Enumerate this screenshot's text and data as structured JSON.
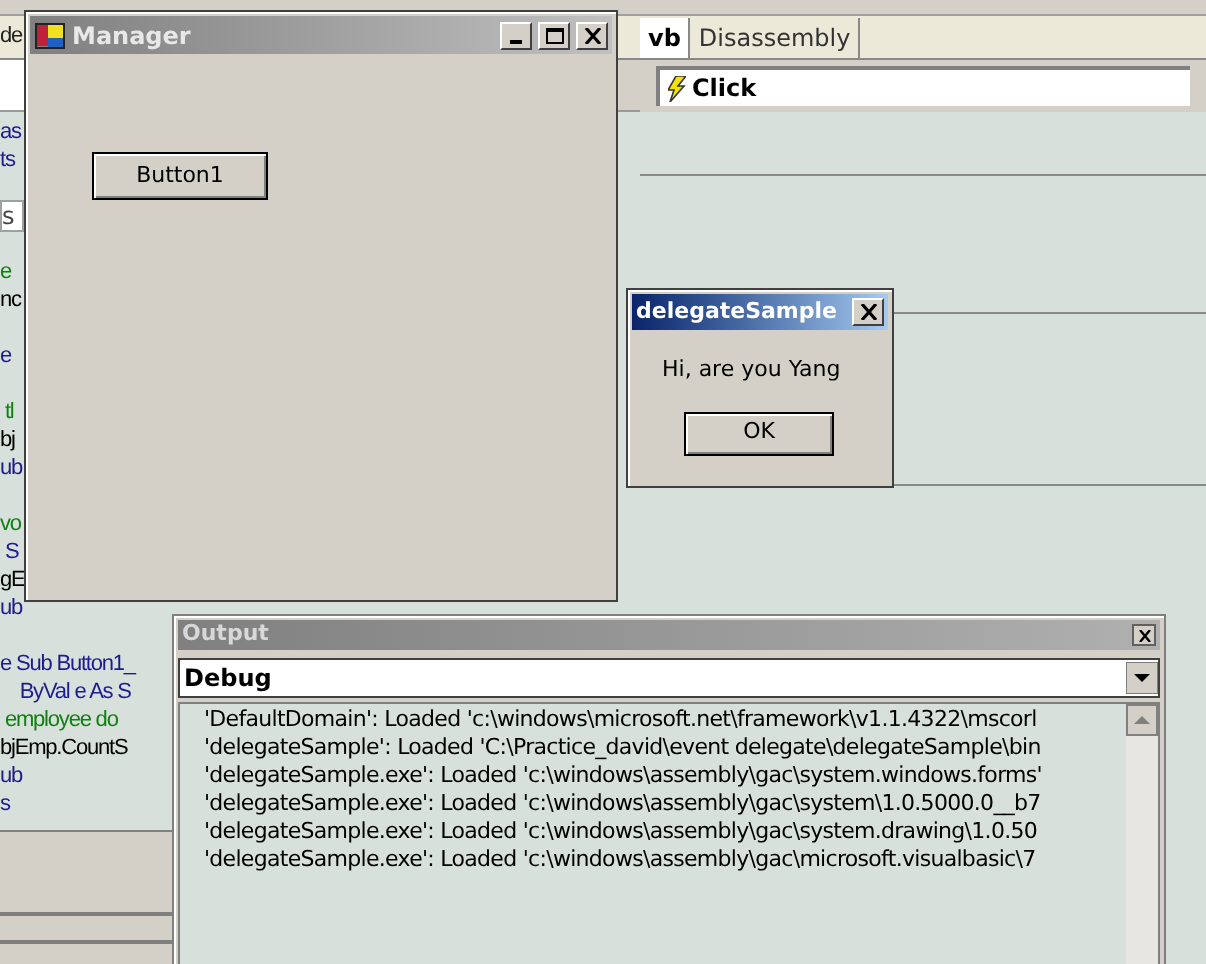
{
  "ide": {
    "left_tab": "de",
    "tabs": [
      {
        "label": "vb",
        "selected": true
      },
      {
        "label": "Disassembly",
        "selected": false
      }
    ],
    "event_combo": {
      "value": "Click"
    },
    "code_lines": [
      {
        "kind": "keyword",
        "text": "as"
      },
      {
        "kind": "keyword",
        "text": "ts"
      },
      {
        "kind": "blank"
      },
      {
        "kind": "field",
        "text": "s"
      },
      {
        "kind": "blank"
      },
      {
        "kind": "comment",
        "text": "e"
      },
      {
        "kind": "plain",
        "text": "nc"
      },
      {
        "kind": "blank"
      },
      {
        "kind": "keyword",
        "text": "e"
      },
      {
        "kind": "blank"
      },
      {
        "kind": "comment",
        "text": " tl"
      },
      {
        "kind": "plain",
        "text": "bj"
      },
      {
        "kind": "keyword",
        "text": "ub"
      },
      {
        "kind": "blank"
      },
      {
        "kind": "comment",
        "text": "vo"
      },
      {
        "kind": "keyword",
        "text": " S"
      },
      {
        "kind": "plain",
        "text": "gE"
      },
      {
        "kind": "keyword",
        "text": "ub"
      },
      {
        "kind": "blank"
      },
      {
        "kind": "keyword",
        "text": "e Sub Button1_"
      },
      {
        "kind": "keyword",
        "text": "    ByVal e As S"
      },
      {
        "kind": "comment",
        "text": " employee do"
      },
      {
        "kind": "plain",
        "text": "bjEmp.CountS"
      },
      {
        "kind": "keyword",
        "text": "ub"
      },
      {
        "kind": "keyword",
        "text": "s"
      }
    ]
  },
  "manager_window": {
    "title": "Manager",
    "button": "Button1"
  },
  "message_box": {
    "title": "delegateSample",
    "message": "Hi, are you Yang",
    "button": "OK"
  },
  "output": {
    "title": "Output",
    "pane": "Debug",
    "lines": [
      "'DefaultDomain': Loaded 'c:\\windows\\microsoft.net\\framework\\v1.1.4322\\mscorl",
      "'delegateSample': Loaded 'C:\\Practice_david\\event delegate\\delegateSample\\bin",
      "'delegateSample.exe': Loaded 'c:\\windows\\assembly\\gac\\system.windows.forms'",
      "'delegateSample.exe': Loaded 'c:\\windows\\assembly\\gac\\system\\1.0.5000.0__b7",
      "'delegateSample.exe': Loaded 'c:\\windows\\assembly\\gac\\system.drawing\\1.0.50",
      "'delegateSample.exe': Loaded 'c:\\windows\\assembly\\gac\\microsoft.visualbasic\\7"
    ]
  }
}
